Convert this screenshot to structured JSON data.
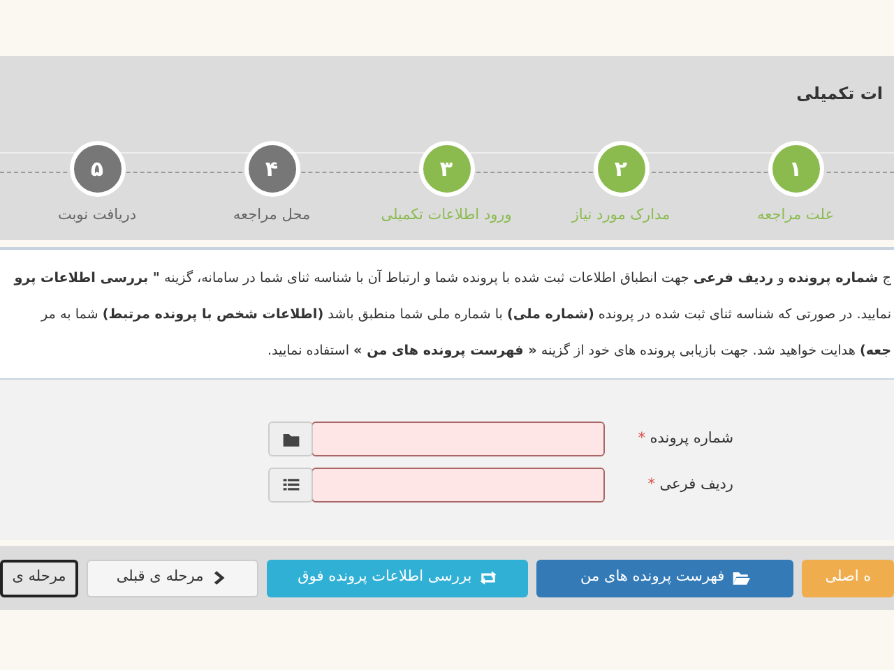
{
  "panel": {
    "title": "ات تکمیلی"
  },
  "steps": [
    {
      "number": "۱",
      "label": "علت مراجعه",
      "done": true
    },
    {
      "number": "۲",
      "label": "مدارک مورد نیاز",
      "done": true
    },
    {
      "number": "۳",
      "label": "ورود اطلاعات تکمیلی",
      "done": true
    },
    {
      "number": "۴",
      "label": "محل مراجعه",
      "done": false
    },
    {
      "number": "۵",
      "label": "دریافت نوبت",
      "done": false
    }
  ],
  "instructions": [
    "ج **شماره پرونده** و **ردیف فرعی** جهت انطباق اطلاعات ثبت شده با پرونده شما و ارتباط آن با شناسه ثنای شما در سامانه، گزینه **\" بررسی اطلاعات پرو**",
    "نمایید. در صورتی که شناسه ثنای ثبت شده در پرونده **(شماره ملی)** با شماره ملی شما منطبق باشد **(اطلاعات شخص با پرونده مرتبط)** شما به مر",
    "**جعه)** هدایت خواهید شد. جهت بازیابی پرونده های خود از گزینه **« فهرست پرونده های من »** استفاده نمایید."
  ],
  "fields": [
    {
      "label": "شماره پرونده",
      "required_mark": "*",
      "invalid": true,
      "kind": "folder"
    },
    {
      "label": "ردیف فرعی",
      "required_mark": "*",
      "invalid": true,
      "kind": "list"
    }
  ],
  "buttons": [
    {
      "label": "ه اصلی",
      "kind": "home"
    },
    {
      "label": "فهرست پرونده های من",
      "kind": "files"
    },
    {
      "label": "بررسی اطلاعات پرونده فوق",
      "kind": "refresh"
    },
    {
      "label": "مرحله ی قبلی",
      "kind": "back"
    },
    {
      "label": "مرحله ی",
      "kind": "next"
    }
  ]
}
